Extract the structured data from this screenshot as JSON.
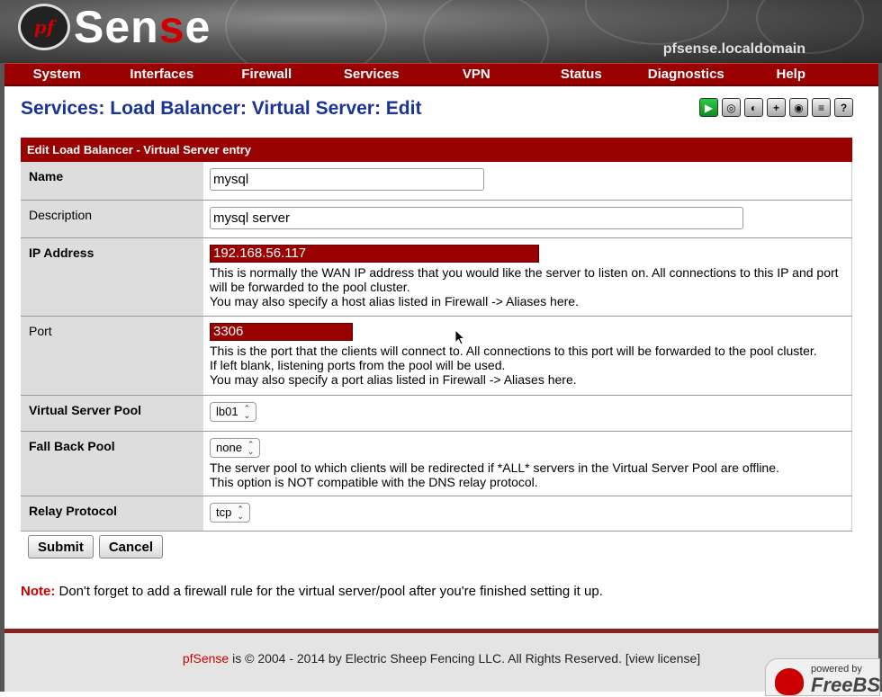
{
  "header": {
    "logo_mark": "pf",
    "logo_text_part1": "S",
    "logo_text_part2": "en",
    "logo_text_part3": "s",
    "logo_text_part4": "e",
    "hostname": "pfsense.localdomain"
  },
  "nav": [
    "System",
    "Interfaces",
    "Firewall",
    "Services",
    "VPN",
    "Status",
    "Diagnostics",
    "Help"
  ],
  "page_title": "Services: Load Balancer: Virtual Server: Edit",
  "toolbar": {
    "icons": [
      "play-icon",
      "status-icon",
      "log-icon",
      "add-icon",
      "settings-icon",
      "list-icon",
      "help-icon"
    ],
    "glyphs": [
      "▶",
      "◎",
      "◐",
      "+",
      "◉",
      "≡",
      "?"
    ]
  },
  "form": {
    "section_title": "Edit Load Balancer - Virtual Server entry",
    "name": {
      "label": "Name",
      "value": "mysql"
    },
    "description": {
      "label": "Description",
      "value": "mysql server"
    },
    "ip_address": {
      "label": "IP Address",
      "value": "192.168.56.117",
      "help1": "This is normally the WAN IP address that you would like the server to listen on. All connections to this IP and port will be forwarded to the pool cluster.",
      "help2": "You may also specify a host alias listed in Firewall -> Aliases here."
    },
    "port": {
      "label": "Port",
      "value": "3306",
      "help1": "This is the port that the clients will connect to. All connections to this port will be forwarded to the pool cluster.",
      "help2": "If left blank, listening ports from the pool will be used.",
      "help3": "You may also specify a port alias listed in Firewall -> Aliases here."
    },
    "virtual_server_pool": {
      "label": "Virtual Server Pool",
      "selected": "lb01"
    },
    "fall_back_pool": {
      "label": "Fall Back Pool",
      "selected": "none",
      "help1": "The server pool to which clients will be redirected if *ALL* servers in the Virtual Server Pool are offline.",
      "help2": "This option is NOT compatible with the DNS relay protocol."
    },
    "relay_protocol": {
      "label": "Relay Protocol",
      "selected": "tcp"
    }
  },
  "buttons": {
    "submit": "Submit",
    "cancel": "Cancel"
  },
  "note": {
    "prefix": "Note:",
    "text": "Don't forget to add a firewall rule for the virtual server/pool after you're finished setting it up."
  },
  "footer": {
    "brand": "pfSense",
    "text": "is © 2004 - 2014 by Electric Sheep Fencing LLC. All Rights Reserved.",
    "license": "[view license]",
    "powered_by": "powered by",
    "freebsd": "FreeBSD"
  },
  "colors": {
    "accent_red": "#990000",
    "title_blue": "#1a3399",
    "label_gray": "#dddddd"
  }
}
